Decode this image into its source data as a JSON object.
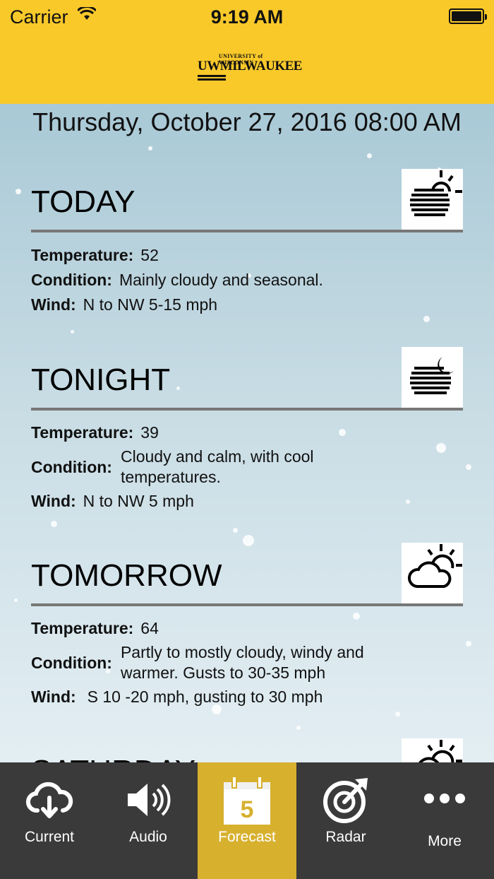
{
  "status_bar": {
    "carrier": "Carrier",
    "time": "9:19 AM"
  },
  "header": {
    "logo_top": "UNIVERSITY of WISCONSIN",
    "logo_main": "UWMILWAUKEE",
    "color": "#F9C92A"
  },
  "date": "Thursday, October 27, 2016 08:00 AM",
  "labels": {
    "temperature": "Temperature:",
    "condition": "Condition:",
    "wind": "Wind:"
  },
  "forecast": [
    {
      "title": "TODAY",
      "icon": "sun-behind-clouds-icon",
      "temperature": "52",
      "condition": "Mainly cloudy and seasonal.",
      "wind": "N to NW 5-15 mph"
    },
    {
      "title": "TONIGHT",
      "icon": "moon-behind-clouds-icon",
      "temperature": "39",
      "condition": "Cloudy and calm, with cool temperatures.",
      "wind": "N to NW 5 mph"
    },
    {
      "title": "TOMORROW",
      "icon": "partly-cloudy-icon",
      "temperature": "64",
      "condition": "Partly to mostly cloudy, windy and warmer.  Gusts to 30-35 mph",
      "wind": "S 10 -20 mph, gusting to 30 mph"
    },
    {
      "title": "SATURDAY",
      "icon": "partly-cloudy-icon"
    }
  ],
  "tabs": [
    {
      "label": "Current",
      "icon": "cloud-download-icon"
    },
    {
      "label": "Audio",
      "icon": "speaker-icon"
    },
    {
      "label": "Forecast",
      "icon": "calendar-icon",
      "badge": "5",
      "active": true
    },
    {
      "label": "Radar",
      "icon": "radar-icon"
    },
    {
      "label": "More",
      "icon": "more-dots-icon"
    }
  ],
  "colors": {
    "tab_active": "#D7B02E",
    "tab_bar": "#3a3a3a"
  }
}
